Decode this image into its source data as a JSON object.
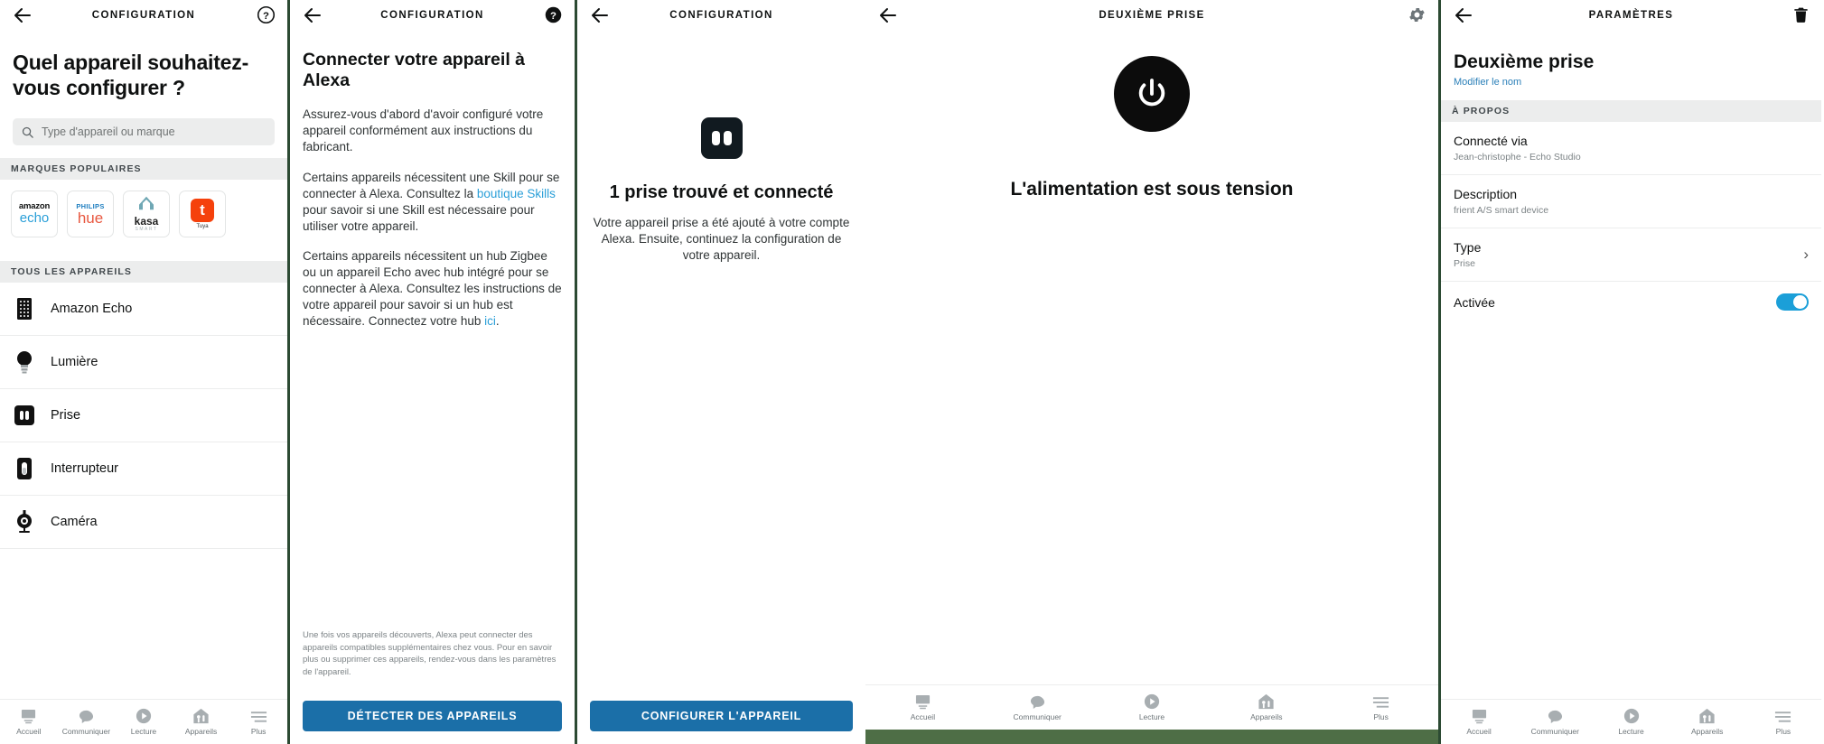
{
  "panel1": {
    "header": {
      "title": "CONFIGURATION",
      "back_icon": "arrow-left-icon",
      "help_icon": "help-circle-icon"
    },
    "heading": "Quel appareil souhaitez-vous configurer ?",
    "search": {
      "placeholder": "Type d'appareil ou marque",
      "value": "",
      "icon": "search-icon"
    },
    "popular_brands_label": "MARQUES POPULAIRES",
    "brands": [
      {
        "name": "amazon-echo-brand",
        "line1": "amazon",
        "line2": "echo"
      },
      {
        "name": "philips-hue-brand",
        "line1": "PHILIPS",
        "line2": "hue"
      },
      {
        "name": "kasa-brand",
        "line1": "",
        "line2": "kasa",
        "line3": "SMART"
      },
      {
        "name": "tuya-brand",
        "line1": "t",
        "line2": "",
        "line3": "Tuya"
      }
    ],
    "all_devices_label": "TOUS LES APPAREILS",
    "devices": [
      {
        "label": "Amazon Echo",
        "icon": "echo-speaker-icon"
      },
      {
        "label": "Lumière",
        "icon": "lightbulb-icon"
      },
      {
        "label": "Prise",
        "icon": "plug-outlet-icon"
      },
      {
        "label": "Interrupteur",
        "icon": "light-switch-icon"
      },
      {
        "label": "Caméra",
        "icon": "camera-icon"
      }
    ],
    "nav": [
      {
        "label": "Accueil",
        "icon": "home-icon"
      },
      {
        "label": "Communiquer",
        "icon": "speech-bubble-icon"
      },
      {
        "label": "Lecture",
        "icon": "play-icon"
      },
      {
        "label": "Appareils",
        "icon": "devices-icon"
      },
      {
        "label": "Plus",
        "icon": "more-menu-icon"
      }
    ]
  },
  "panel2": {
    "header": {
      "title": "CONFIGURATION",
      "back_icon": "arrow-left-icon",
      "help_icon": "help-circle-filled-icon"
    },
    "heading": "Connecter votre appareil à Alexa",
    "para1": "Assurez-vous d'abord d'avoir configuré votre appareil conformément aux instructions du fabricant.",
    "para2_a": "Certains appareils nécessitent une Skill pour se connecter à Alexa. Consultez la ",
    "para2_link": "boutique Skills",
    "para2_b": " pour savoir si une Skill est nécessaire pour utiliser votre appareil.",
    "para3_a": "Certains appareils nécessitent un hub Zigbee ou un appareil Echo avec hub intégré pour se connecter à Alexa. Consultez les instructions de votre appareil pour savoir si un hub est nécessaire. Connectez votre hub ",
    "para3_link": "ici",
    "para3_b": ".",
    "disclaimer": "Une fois vos appareils découverts, Alexa peut connecter des appareils compatibles supplémentaires chez vous. Pour en savoir plus ou supprimer ces appareils, rendez-vous dans les paramètres de l'appareil.",
    "cta_label": "DÉTECTER DES APPAREILS"
  },
  "panel3": {
    "header": {
      "title": "CONFIGURATION",
      "back_icon": "arrow-left-icon"
    },
    "badge_icon": "plug-outlet-icon",
    "heading": "1 prise trouvé et connecté",
    "subtext": "Votre appareil prise a été ajouté à votre compte Alexa. Ensuite, continuez la configuration de votre appareil.",
    "cta_label": "CONFIGURER L'APPAREIL"
  },
  "panel4": {
    "header": {
      "title": "DEUXIÈME PRISE",
      "back_icon": "arrow-left-icon",
      "gear_icon": "gear-icon"
    },
    "power_icon": "power-button-icon",
    "heading": "L'alimentation est sous tension",
    "nav": [
      {
        "label": "Accueil",
        "icon": "home-icon"
      },
      {
        "label": "Communiquer",
        "icon": "speech-bubble-icon"
      },
      {
        "label": "Lecture",
        "icon": "play-icon"
      },
      {
        "label": "Appareils",
        "icon": "devices-icon"
      },
      {
        "label": "Plus",
        "icon": "more-menu-icon"
      }
    ]
  },
  "panel5": {
    "header": {
      "title": "PARAMÈTRES",
      "back_icon": "arrow-left-icon",
      "trash_icon": "trash-icon"
    },
    "device_name": "Deuxième prise",
    "edit_link": "Modifier le nom",
    "about_label": "À PROPOS",
    "rows": [
      {
        "key": "Connecté via",
        "value": "Jean-christophe - Echo Studio",
        "control": "none"
      },
      {
        "key": "Description",
        "value": "frient A/S smart device",
        "control": "none"
      },
      {
        "key": "Type",
        "value": "Prise",
        "control": "chevron"
      },
      {
        "key": "Activée",
        "value": "",
        "control": "toggle"
      }
    ],
    "toggle_color": "#1b9fd8",
    "nav": [
      {
        "label": "Accueil",
        "icon": "home-icon"
      },
      {
        "label": "Communiquer",
        "icon": "speech-bubble-icon"
      },
      {
        "label": "Lecture",
        "icon": "play-icon"
      },
      {
        "label": "Appareils",
        "icon": "devices-icon"
      },
      {
        "label": "Plus",
        "icon": "more-menu-icon"
      }
    ]
  },
  "colors": {
    "accent_blue": "#2a9fd8",
    "button_blue": "#1b6fa8",
    "dark": "#0f1111",
    "divider": "#2c4a33"
  }
}
